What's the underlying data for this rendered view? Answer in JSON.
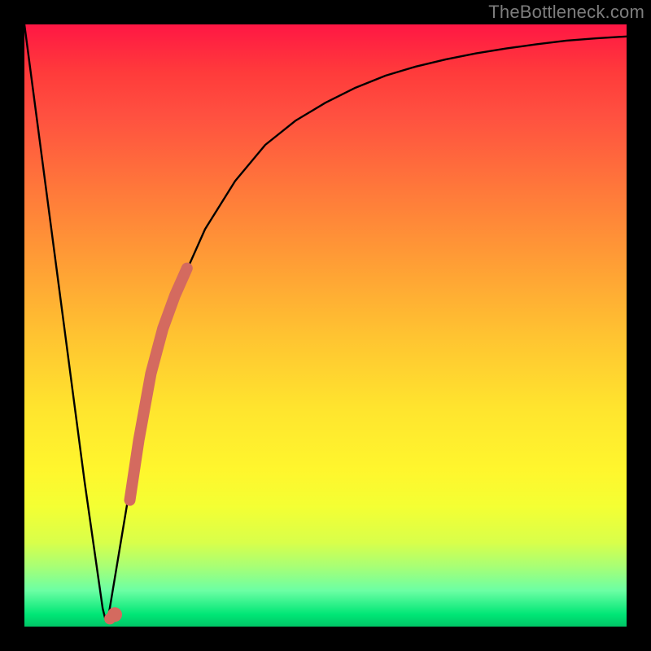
{
  "watermark": "TheBottleneck.com",
  "chart_data": {
    "type": "line",
    "title": "",
    "xlabel": "",
    "ylabel": "",
    "xlim": [
      0,
      100
    ],
    "ylim": [
      0,
      100
    ],
    "series": [
      {
        "name": "bottleneck-curve",
        "x": [
          0,
          5,
          10,
          13,
          13.5,
          14,
          15,
          17,
          20,
          23,
          26,
          30,
          35,
          40,
          45,
          50,
          55,
          60,
          65,
          70,
          75,
          80,
          85,
          90,
          95,
          100
        ],
        "values": [
          100,
          62,
          24,
          3,
          1,
          2,
          8,
          20,
          36,
          48,
          57,
          66,
          74,
          80,
          84,
          87,
          89.5,
          91.5,
          93,
          94.2,
          95.2,
          96,
          96.7,
          97.3,
          97.7,
          98
        ]
      },
      {
        "name": "highlight-segment",
        "x": [
          14.2,
          15.0,
          15.5,
          17.5,
          19.0,
          21.0,
          23.0,
          25.0,
          27.0
        ],
        "values": [
          1.3,
          2.0,
          2.2,
          21.0,
          31.0,
          42.0,
          49.5,
          55.0,
          59.5
        ]
      }
    ],
    "colors": {
      "curve": "#000000",
      "highlight": "#d46a5f"
    }
  }
}
